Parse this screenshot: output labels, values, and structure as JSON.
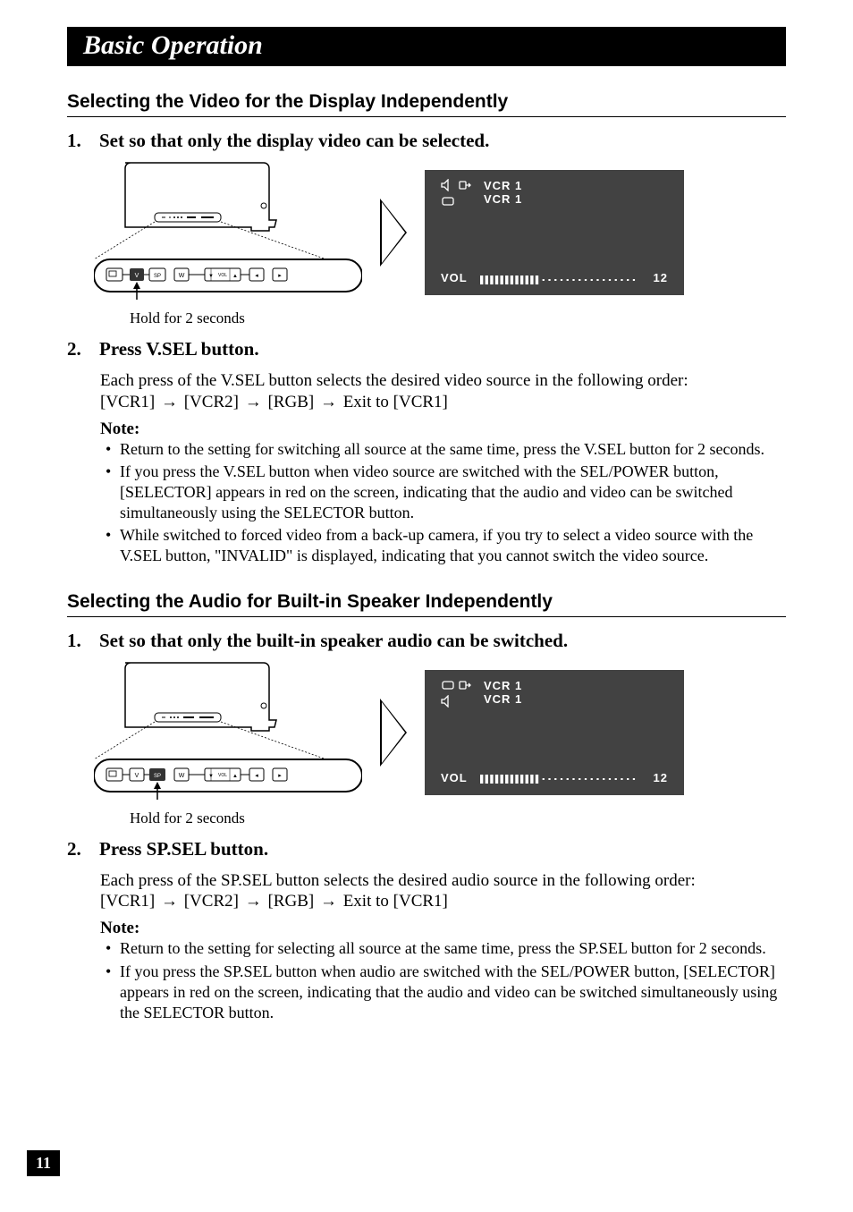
{
  "chapter_title": "Basic Operation",
  "section1": {
    "heading": "Selecting the Video for the Display Independently",
    "step1": {
      "num": "1.",
      "text": "Set so that only the display video can be selected."
    },
    "caption": "Hold for 2 seconds",
    "osd": {
      "line1": "VCR 1",
      "line2": "VCR 1",
      "vol_label": "VOL",
      "vol_value": "12"
    },
    "step2": {
      "num": "2.",
      "text": "Press V.SEL button."
    },
    "body": "Each press of the V.SEL button selects the desired video source in the following order:",
    "sequence": {
      "s1": "[VCR1]",
      "s2": "[VCR2]",
      "s3": "[RGB]",
      "s4": "Exit to [VCR1]"
    },
    "note_label": "Note:",
    "notes": {
      "n1": "Return to the setting for switching all source at the same time, press the V.SEL button for 2 seconds.",
      "n2": "If you press the V.SEL button when video source are switched with the SEL/POWER button, [SELECTOR] appears in red on the screen, indicating that the audio and video can be switched simultaneously using the SELECTOR button.",
      "n3": "While switched to forced video from a back-up camera, if you try to select a video source with the V.SEL button, \"INVALID\" is displayed, indicating that you cannot switch the video source."
    }
  },
  "section2": {
    "heading": "Selecting the Audio for Built-in Speaker Independently",
    "step1": {
      "num": "1.",
      "text": "Set so that only the built-in speaker audio can be switched."
    },
    "caption": "Hold for 2 seconds",
    "osd": {
      "line1": "VCR 1",
      "line2": "VCR 1",
      "vol_label": "VOL",
      "vol_value": "12"
    },
    "step2": {
      "num": "2.",
      "text": "Press SP.SEL button."
    },
    "body": "Each press of the SP.SEL button selects the desired audio source in the following order:",
    "sequence": {
      "s1": "[VCR1]",
      "s2": "[VCR2]",
      "s3": "[RGB]",
      "s4": "Exit to [VCR1]"
    },
    "note_label": "Note:",
    "notes": {
      "n1": "Return to the setting for selecting all source at the same time, press the SP.SEL button for 2 seconds.",
      "n2": "If you press the SP.SEL button when audio are switched with the SEL/POWER button, [SELECTOR] appears in red on the screen, indicating that the audio and video can be switched simultaneously using the SELECTOR button."
    }
  },
  "page_number": "11",
  "chart_data": {
    "type": "table",
    "description": "Volume OSD bar indicator",
    "categories": [
      "Volume level"
    ],
    "values": [
      12
    ],
    "ylim": [
      0,
      30
    ]
  }
}
